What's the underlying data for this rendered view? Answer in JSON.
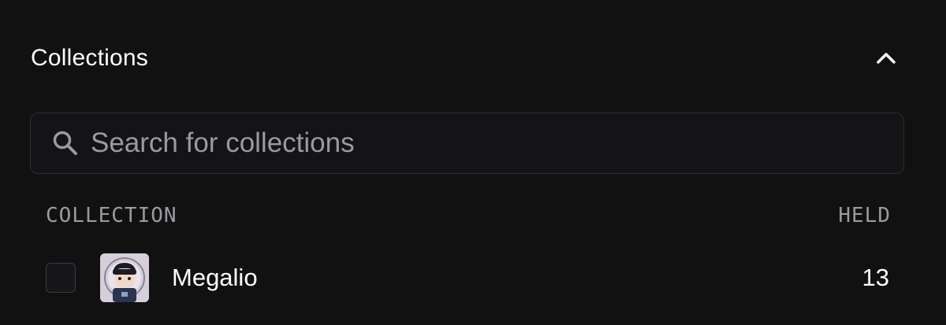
{
  "panel": {
    "title": "Collections",
    "header_icon": "chevron-up-icon"
  },
  "search": {
    "placeholder": "Search for collections",
    "value": "",
    "icon": "search-icon"
  },
  "table": {
    "columns": [
      "COLLECTION",
      "HELD"
    ],
    "rows": [
      {
        "name": "Megalio",
        "held": "13",
        "checked": false,
        "avatar_icon": "collection-avatar"
      }
    ]
  },
  "colors": {
    "background": "#121112",
    "text": "#ffffff",
    "muted": "#9a9aa0",
    "border": "#2e2d33"
  }
}
